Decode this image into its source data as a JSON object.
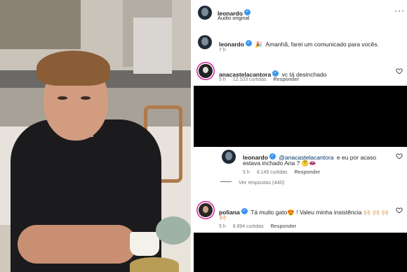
{
  "header": {
    "username": "leonardo",
    "audio_label": "Áudio original",
    "more_icon": "more-horizontal-icon"
  },
  "caption": {
    "username": "leonardo",
    "emoji": "🎉",
    "text": "Amanhã, farei um comunicado para vocês.",
    "time": "7 h"
  },
  "comments": [
    {
      "username": "anacastelacantora",
      "text": "vc tá desinchado",
      "time": "5 h",
      "likes": "12.103 curtidas",
      "reply_label": "Responder"
    },
    {
      "username": "leonardo",
      "mention": "@anacastelacantora",
      "text_line1": "e eu por acaso",
      "text_line2": "estava inchado Ana ? 🤔👄",
      "time": "5 h",
      "likes": "4.149 curtidas",
      "reply_label": "Responder"
    },
    {
      "username": "poliana",
      "text_line1": "Tá muito gato😍 ! Valeu minha insistência 🙌🏻 🙌🏻 🙌🏻",
      "text_line2": "🙌🏻",
      "time": "5 h",
      "likes": "8.894 curtidas",
      "reply_label": "Responder"
    }
  ],
  "view_replies": "Ver respostas (440)",
  "colors": {
    "verified": "#3897f0",
    "mention": "#00376b",
    "story_ring": "#d6249f",
    "muted": "#737373"
  }
}
